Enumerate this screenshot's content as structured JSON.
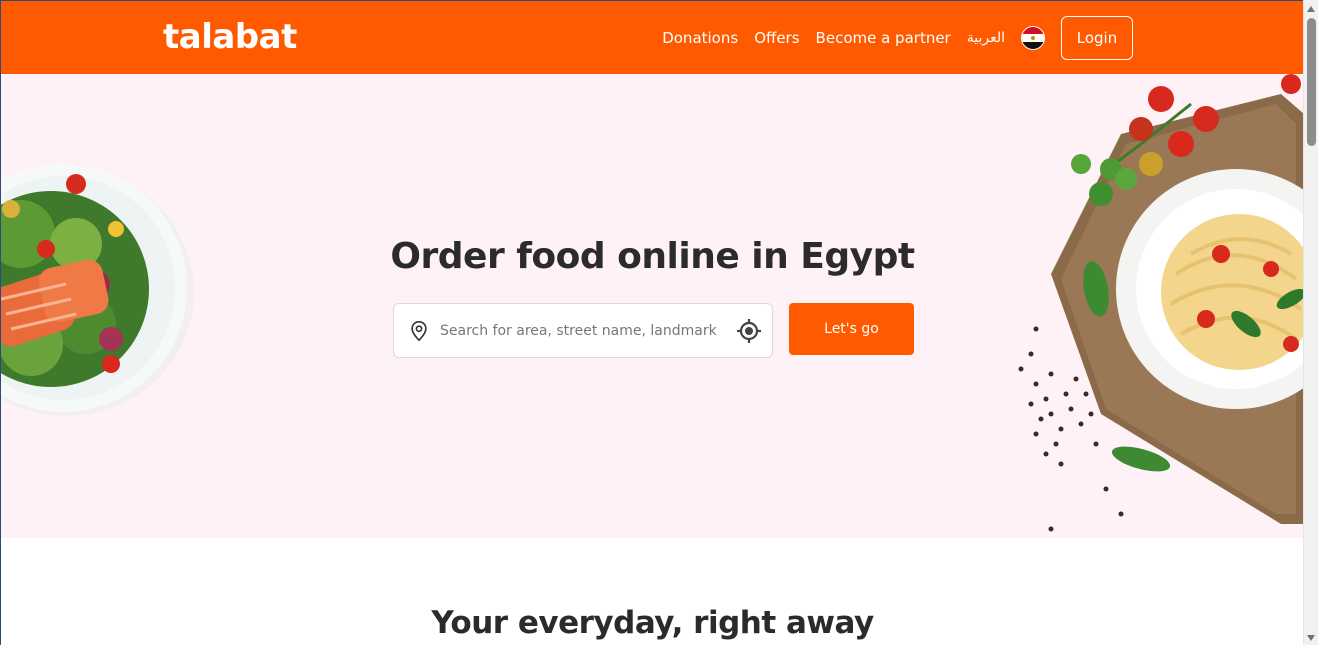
{
  "header": {
    "logo": "talabat",
    "nav": {
      "donations": "Donations",
      "offers": "Offers",
      "partner": "Become a partner",
      "language": "العربية"
    },
    "login_label": "Login",
    "flag_icon": "egypt-flag-icon"
  },
  "hero": {
    "title": "Order food online in Egypt",
    "search": {
      "placeholder": "Search for area, street name, landmark",
      "value": ""
    },
    "cta_label": "Let's go",
    "images": [
      "salmon-salad-plate",
      "pasta-plate-with-tomatoes"
    ]
  },
  "section": {
    "title": "Your everyday, right away"
  },
  "colors": {
    "brand": "#ff5a00",
    "hero_bg": "#fff2f6",
    "text": "#2b2b2b"
  },
  "icons": {
    "search_field": "location-pin-icon",
    "locate": "crosshair-locate-icon"
  }
}
